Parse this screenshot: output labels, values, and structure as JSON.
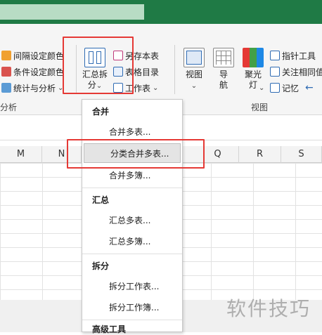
{
  "ribbon": {
    "left_group": {
      "items": [
        {
          "label": "间隔设定颜色",
          "color": "#f0a030"
        },
        {
          "label": "条件设定颜色",
          "color": "#d9534f"
        },
        {
          "label": "统计与分析",
          "color": "#5b9bd5"
        }
      ],
      "group_label": "分析"
    },
    "summary_button": {
      "label_line1": "汇总拆",
      "label_line2": "分"
    },
    "small_buttons": [
      {
        "label": "另存本表",
        "color": "#c0397a"
      },
      {
        "label": "表格目录",
        "color": "#2f6bb3"
      },
      {
        "label": "工作表"
      }
    ],
    "view_buttons": [
      {
        "label": "视图",
        "dropdown": true
      },
      {
        "label": "导\n航"
      },
      {
        "label": "聚光\n灯",
        "dropdown": true
      }
    ],
    "right_items": [
      {
        "label": "指针工具"
      },
      {
        "label": "关注相同值"
      },
      {
        "label": "记忆"
      }
    ],
    "view_group_label": "视图"
  },
  "columns": [
    "M",
    "N",
    "Q",
    "R",
    "S"
  ],
  "menu": {
    "sections": [
      {
        "header": "合并",
        "items": [
          "合并多表...",
          "分类合并多表...",
          "合并多簿..."
        ]
      },
      {
        "header": "汇总",
        "items": [
          "汇总多表...",
          "汇总多簿..."
        ]
      },
      {
        "header": "拆分",
        "items": [
          "拆分工作表...",
          "拆分工作簿..."
        ]
      },
      {
        "header": "高级工具",
        "items": []
      }
    ],
    "selected_item": "分类合并多表..."
  },
  "watermark": "软件技巧"
}
